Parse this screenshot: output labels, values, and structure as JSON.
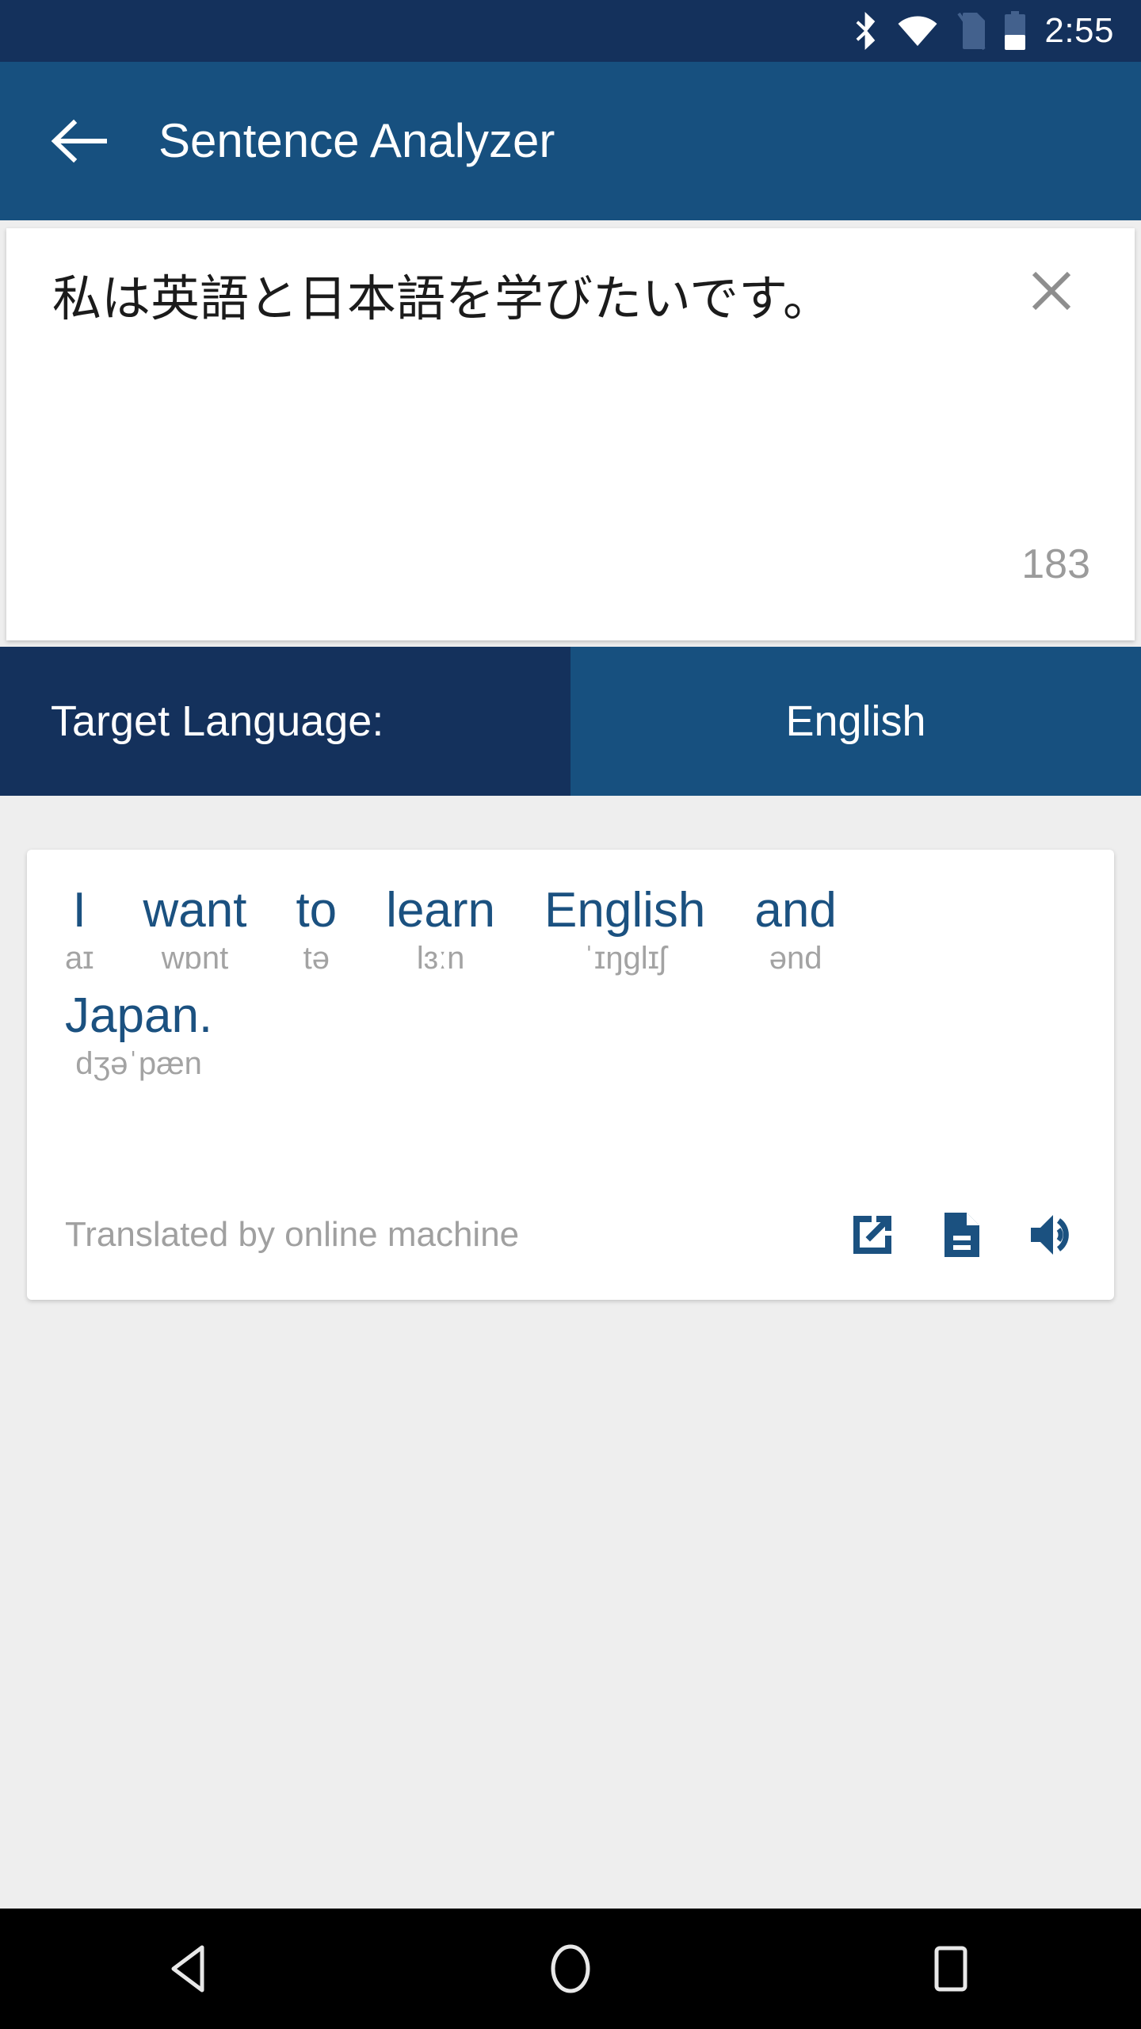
{
  "status_bar": {
    "time": "2:55",
    "icons": [
      "bluetooth-icon",
      "wifi-icon",
      "no-sim-icon",
      "battery-icon"
    ],
    "background_color": "#14315c"
  },
  "app_bar": {
    "back_label": "back-arrow-icon",
    "title": "Sentence Analyzer",
    "background_color": "#17507f"
  },
  "input_card": {
    "text": "私は英語と日本語を学びたいです。",
    "placeholder": "",
    "clear_icon": "close-icon",
    "char_count": "183"
  },
  "language_selector": {
    "label": "Target Language:",
    "value": "English",
    "label_background": "#14315c",
    "value_background": "#17507f"
  },
  "result_card": {
    "words": [
      {
        "word": "I",
        "ipa": "aɪ"
      },
      {
        "word": "want",
        "ipa": "wɒnt"
      },
      {
        "word": "to",
        "ipa": "tə"
      },
      {
        "word": "learn",
        "ipa": "lɜːn"
      },
      {
        "word": "English",
        "ipa": "ˈɪŋɡlɪʃ"
      },
      {
        "word": "and",
        "ipa": "ənd"
      },
      {
        "word": "Japan.",
        "ipa": "dʒəˈpæn"
      }
    ],
    "source_note": "Translated by online machine",
    "actions": [
      {
        "name": "open-in-new-icon",
        "label": "Open in new"
      },
      {
        "name": "document-icon",
        "label": "Document"
      },
      {
        "name": "volume-icon",
        "label": "Speak"
      }
    ],
    "word_color": "#1b5180",
    "ipa_color": "#a3a3a3"
  },
  "nav_bar": {
    "buttons": [
      "back-triangle-icon",
      "home-circle-icon",
      "recents-square-icon"
    ],
    "background_color": "#000000"
  },
  "page": {
    "background_color": "#eeeeee"
  }
}
